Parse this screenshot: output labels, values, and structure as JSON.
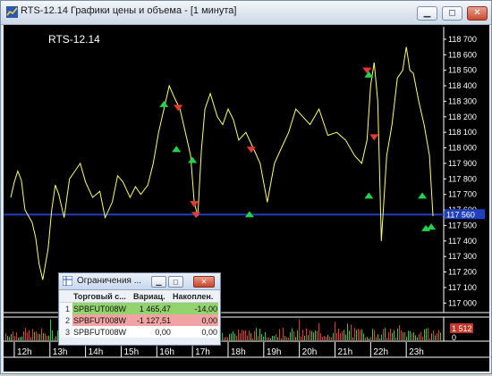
{
  "window": {
    "title": "RTS-12.14 Графики цены и объема - [1 минута]",
    "buttons": [
      "minimize",
      "restore",
      "close"
    ]
  },
  "chart": {
    "label": "RTS-12.14",
    "background": "#000000",
    "line_color": "#ffff66",
    "level_line_color": "#1f3fbf",
    "current_price_label": "117 560",
    "current_price_bg": "#1f3fbf",
    "volume_label": "1 512",
    "volume_label_bg": "#c0392b",
    "volume_zero": "0"
  },
  "chart_data": {
    "type": "line",
    "title": "RTS-12.14",
    "y_ticks": [
      "118 700",
      "118 600",
      "118 500",
      "118 400",
      "118 300",
      "118 200",
      "118 100",
      "118 000",
      "117 900",
      "117 800",
      "117 700",
      "117 600",
      "117 500",
      "117 400",
      "117 300",
      "117 200",
      "117 100",
      "117 000"
    ],
    "y_tick_values": [
      118700,
      118600,
      118500,
      118400,
      118300,
      118200,
      118100,
      118000,
      117900,
      117800,
      117700,
      117600,
      117500,
      117400,
      117300,
      117200,
      117100,
      117000
    ],
    "x_ticks": [
      "12h",
      "13h",
      "14h",
      "15h",
      "16h",
      "17h",
      "18h",
      "19h",
      "20h",
      "21h",
      "22h",
      "23h"
    ],
    "x": [
      11.9,
      12.0,
      12.1,
      12.2,
      12.3,
      12.5,
      12.6,
      12.7,
      12.8,
      12.95,
      13.05,
      13.15,
      13.25,
      13.4,
      13.55,
      13.7,
      13.85,
      14.0,
      14.2,
      14.4,
      14.55,
      14.75,
      14.9,
      15.05,
      15.25,
      15.4,
      15.55,
      15.75,
      15.9,
      16.05,
      16.2,
      16.35,
      16.5,
      16.65,
      16.75,
      16.85,
      16.95,
      17.05,
      17.15,
      17.25,
      17.35,
      17.5,
      17.7,
      17.85,
      18.0,
      18.15,
      18.3,
      18.5,
      18.7,
      18.9,
      19.1,
      19.3,
      19.5,
      19.7,
      19.9,
      20.1,
      20.3,
      20.55,
      20.8,
      21.05,
      21.3,
      21.55,
      21.75,
      21.9,
      22.0,
      22.1,
      22.2,
      22.3,
      22.45,
      22.6,
      22.75,
      22.9,
      23.0,
      23.1,
      23.2,
      23.35,
      23.5,
      23.65,
      23.75
    ],
    "y": [
      117680,
      117780,
      117850,
      117790,
      117600,
      117520,
      117420,
      117250,
      117150,
      117350,
      117600,
      117760,
      117700,
      117550,
      117800,
      117850,
      117900,
      117780,
      117680,
      117720,
      117550,
      117650,
      117820,
      117780,
      117680,
      117750,
      117700,
      117760,
      117900,
      118100,
      118250,
      118400,
      118320,
      118250,
      118150,
      118050,
      117950,
      117650,
      117560,
      117980,
      118250,
      118350,
      118200,
      118150,
      118250,
      118180,
      118050,
      118100,
      118000,
      117900,
      117650,
      117900,
      118000,
      118100,
      118250,
      118200,
      118150,
      118250,
      118080,
      118100,
      118050,
      117950,
      117900,
      118050,
      118400,
      118550,
      118300,
      117400,
      117950,
      118150,
      118450,
      118500,
      118650,
      118500,
      118480,
      118300,
      118150,
      117950,
      117560
    ],
    "markers": [
      {
        "x": 16.2,
        "y": 118280,
        "kind": "buy"
      },
      {
        "x": 16.6,
        "y": 118260,
        "kind": "sell"
      },
      {
        "x": 16.55,
        "y": 117990,
        "kind": "buy"
      },
      {
        "x": 17.0,
        "y": 117920,
        "kind": "buy"
      },
      {
        "x": 17.05,
        "y": 117640,
        "kind": "sell"
      },
      {
        "x": 17.1,
        "y": 117570,
        "kind": "sell"
      },
      {
        "x": 18.65,
        "y": 117990,
        "kind": "sell"
      },
      {
        "x": 18.6,
        "y": 117570,
        "kind": "buy"
      },
      {
        "x": 21.9,
        "y": 118500,
        "kind": "sell"
      },
      {
        "x": 21.95,
        "y": 118470,
        "kind": "buy"
      },
      {
        "x": 22.1,
        "y": 118070,
        "kind": "sell"
      },
      {
        "x": 21.95,
        "y": 117690,
        "kind": "buy"
      },
      {
        "x": 23.45,
        "y": 117690,
        "kind": "buy"
      },
      {
        "x": 23.55,
        "y": 117480,
        "kind": "buy"
      },
      {
        "x": 23.7,
        "y": 117490,
        "kind": "buy"
      }
    ],
    "level_line": 117570,
    "xlim": [
      11.7,
      24.05
    ],
    "ylim": [
      116950,
      118780
    ],
    "grid": false,
    "colors": {
      "buy": "#22d34a",
      "sell": "#e53935",
      "line": "#ffff66"
    }
  },
  "dialog": {
    "title": "Ограничения ...",
    "headers": [
      "",
      "Торговый с...",
      "Вариац.",
      "Накоплен."
    ],
    "rows": [
      {
        "n": "1",
        "account": "SPBFUT008W",
        "var": "1 465,47",
        "acc": "-14,00",
        "status": "green"
      },
      {
        "n": "2",
        "account": "SPBFUT008W",
        "var": "-1 127,51",
        "acc": "0,00",
        "status": "red"
      },
      {
        "n": "3",
        "account": "SPBFUT008W",
        "var": "0,00",
        "acc": "0,00",
        "status": "none"
      }
    ]
  }
}
